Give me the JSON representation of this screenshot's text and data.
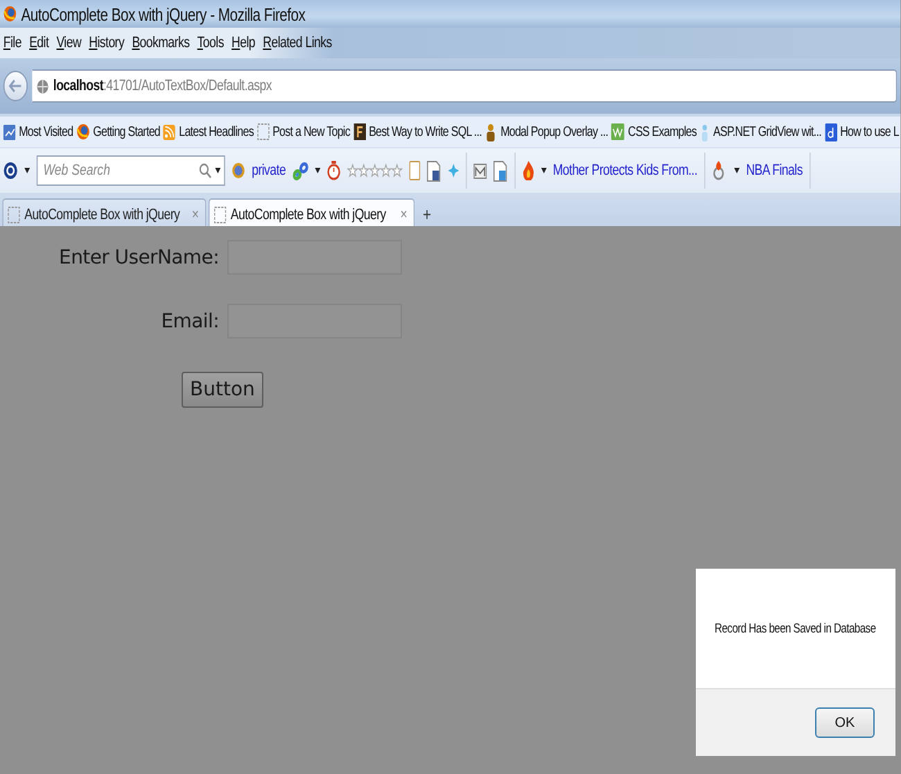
{
  "window": {
    "title": "AutoComplete Box with jQuery - Mozilla Firefox"
  },
  "menu": [
    "File",
    "Edit",
    "View",
    "History",
    "Bookmarks",
    "Tools",
    "Help",
    "Related Links"
  ],
  "address": {
    "host": "localhost",
    "path": ":41701/AutoTextBox/Default.aspx"
  },
  "bookmarks": [
    "Most Visited",
    "Getting Started",
    "Latest Headlines",
    "Post a New Topic",
    "Best Way to Write SQL ...",
    "Modal Popup Overlay ...",
    "CSS Examples",
    "ASP.NET GridView wit...",
    "How to use L"
  ],
  "toolbar": {
    "search": {
      "placeholder": "Web Search"
    },
    "private_link": "private",
    "news_link": "Mother Protects Kids From...",
    "sports_link": "NBA Finals"
  },
  "tabs": [
    {
      "label": "AutoComplete Box with jQuery",
      "selected": false,
      "close": "×"
    },
    {
      "label": "AutoComplete Box with jQuery",
      "selected": true,
      "close": "×"
    }
  ],
  "new_tab": "+",
  "form": {
    "fields": [
      {
        "label": "Enter UserName:"
      },
      {
        "label": "Email:"
      }
    ],
    "button": "Button"
  },
  "dialog": {
    "message": "Record Has been Saved in Database",
    "button": "OK"
  }
}
